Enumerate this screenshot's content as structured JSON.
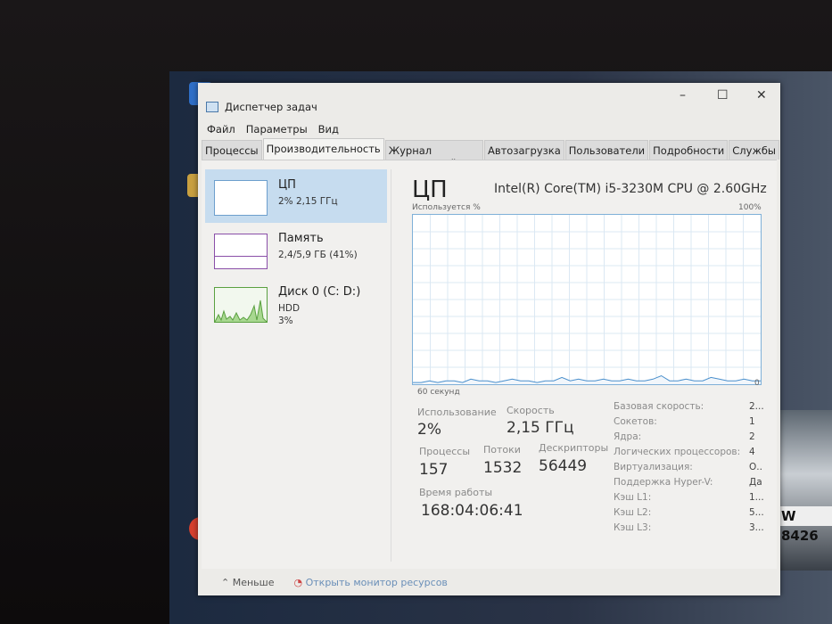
{
  "window": {
    "title": "Диспетчер задач",
    "minimize": "–",
    "maximize": "☐",
    "close": "✕"
  },
  "menu": [
    "Файл",
    "Параметры",
    "Вид"
  ],
  "tabs": [
    "Процессы",
    "Производительность",
    "Журнал приложений",
    "Автозагрузка",
    "Пользователи",
    "Подробности",
    "Службы"
  ],
  "active_tab": 1,
  "sidebar": [
    {
      "name": "ЦП",
      "sub": "2% 2,15 ГГц"
    },
    {
      "name": "Память",
      "sub": "2,4/5,9 ГБ (41%)"
    },
    {
      "name": "Диск 0 (C: D:)",
      "sub": "HDD",
      "sub2": "3%"
    }
  ],
  "main": {
    "title": "ЦП",
    "cpu_model": "Intel(R) Core(TM) i5-3230M CPU @ 2.60GHz",
    "graph_label": "Используется %",
    "graph_max": "100%",
    "graph_time": "60 секунд",
    "graph_min": "0",
    "cpu_history": [
      1,
      1,
      2,
      1,
      2,
      2,
      1,
      3,
      2,
      2,
      1,
      2,
      3,
      2,
      2,
      1,
      2,
      2,
      4,
      2,
      3,
      2,
      2,
      3,
      2,
      2,
      3,
      2,
      2,
      3,
      5,
      2,
      2,
      3,
      2,
      2,
      4,
      3,
      2,
      2,
      3,
      2,
      2
    ],
    "stats": {
      "usage_label": "Использование",
      "usage": "2%",
      "speed_label": "Скорость",
      "speed": "2,15 ГГц",
      "proc_label": "Процессы",
      "proc": "157",
      "threads_label": "Потоки",
      "threads": "1532",
      "handles_label": "Дескрипторы",
      "handles": "56449",
      "uptime_label": "Время работы",
      "uptime": "168:04:06:41"
    },
    "specs": [
      {
        "k": "Базовая скорость:",
        "v": "2..."
      },
      {
        "k": "Сокетов:",
        "v": "1"
      },
      {
        "k": "Ядра:",
        "v": "2"
      },
      {
        "k": "Логических процессоров:",
        "v": "4"
      },
      {
        "k": "Виртуализация:",
        "v": "О.."
      },
      {
        "k": "Поддержка Hyper-V:",
        "v": "Да"
      },
      {
        "k": "Кэш L1:",
        "v": "1..."
      },
      {
        "k": "Кэш L2:",
        "v": "5..."
      },
      {
        "k": "Кэш L3:",
        "v": "3..."
      }
    ]
  },
  "footer": {
    "less": "Меньше",
    "monitor": "Открыть монитор ресурсов"
  },
  "plate": "W 8426"
}
